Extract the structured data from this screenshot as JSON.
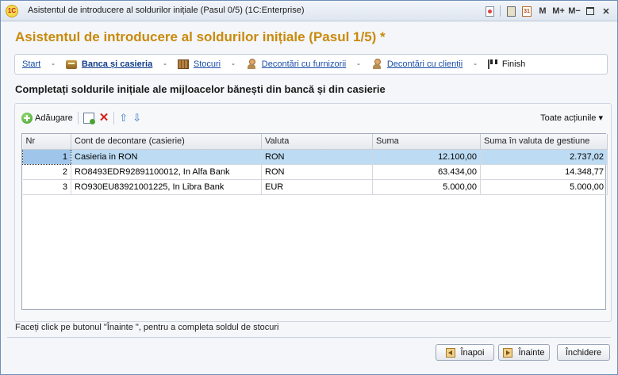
{
  "window": {
    "title": "Asistentul de introducere al soldurilor inițiale (Pasul 0/5)  (1C:Enterprise)",
    "logo_text": "1C",
    "tools": {
      "m": "M",
      "m_plus": "M+",
      "m_minus": "M−",
      "calendar_text": "31"
    }
  },
  "heading": "Asistentul de introducere al soldurilor inițiale (Pasul 1/5) *",
  "steps": [
    {
      "label": "Start",
      "state": "link"
    },
    {
      "label": "Banca și casieria",
      "state": "active",
      "icon": "bank-icon"
    },
    {
      "label": "Stocuri",
      "state": "link",
      "icon": "stock-icon"
    },
    {
      "label": "Decontări cu furnizorii",
      "state": "link",
      "icon": "person-icon"
    },
    {
      "label": "Decontări cu clienții",
      "state": "link",
      "icon": "person-icon"
    },
    {
      "label": "Finish",
      "state": "plain",
      "icon": "finish-flag-icon"
    }
  ],
  "step_separator": "-",
  "subheading": "Completați soldurile inițiale ale mijloacelor bănești din bancă și din casierie",
  "toolbar": {
    "add_label": "Adăugare",
    "all_actions_label": "Toate acțiunile"
  },
  "table": {
    "columns": [
      "Nr",
      "Cont de decontare (casierie)",
      "Valuta",
      "Suma",
      "Suma în valuta de gestiune"
    ],
    "rows": [
      {
        "nr": "1",
        "account": "Casieria in RON",
        "currency": "RON",
        "amount": "12.100,00",
        "amount_mgmt": "2.737,02",
        "selected": true
      },
      {
        "nr": "2",
        "account": "RO8493EDR92891100012, In Alfa Bank",
        "currency": "RON",
        "amount": "63.434,00",
        "amount_mgmt": "14.348,77",
        "selected": false
      },
      {
        "nr": "3",
        "account": "RO930EU83921001225, In Libra Bank",
        "currency": "EUR",
        "amount": "5.000,00",
        "amount_mgmt": "5.000,00",
        "selected": false
      }
    ]
  },
  "hint": "Faceți click pe butonul \"Înainte \", pentru a completa soldul de stocuri",
  "buttons": {
    "back": "Înapoi",
    "next": "Înainte",
    "close": "Închidere"
  },
  "colors": {
    "heading": "#c98a0c",
    "link": "#1a4ea8",
    "selected_row": "#bddcf4"
  }
}
